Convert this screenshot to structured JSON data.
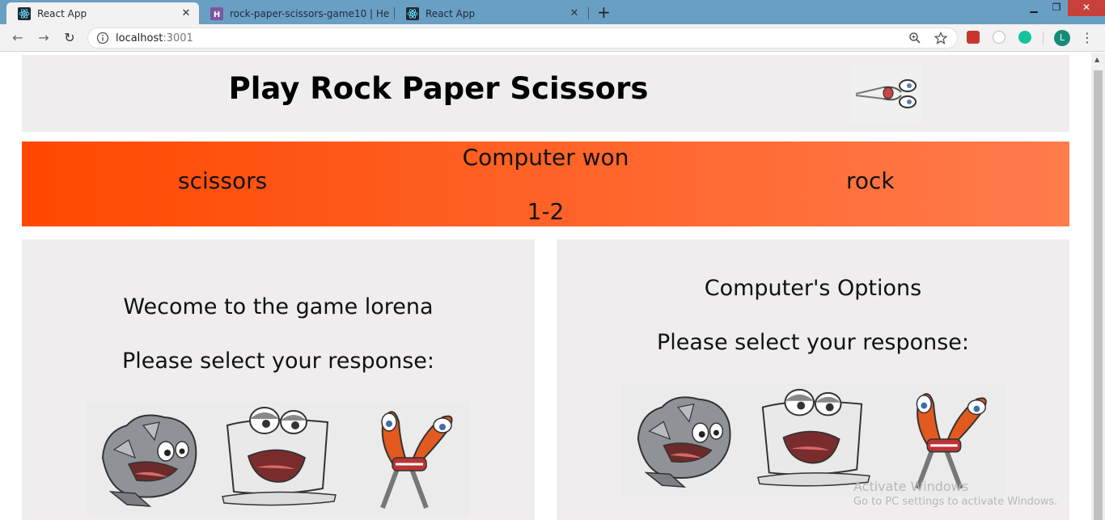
{
  "browser": {
    "tabs": [
      {
        "title": "React App",
        "active": true
      },
      {
        "title": "rock-paper-scissors-game10 | He",
        "active": false
      },
      {
        "title": "React App",
        "active": false
      }
    ],
    "close_glyph": "✕",
    "new_tab_glyph": "+",
    "url_host": "localhost",
    "url_port": ":3001",
    "profile_initial": "L",
    "accent": "#6a9fc4"
  },
  "header": {
    "title": "Play Rock Paper Scissors"
  },
  "result": {
    "status": "Computer won",
    "user_choice": "scissors",
    "computer_choice": "rock",
    "score": "1-2",
    "gradient_from": "#ff4800",
    "gradient_to": "#ff7c4d"
  },
  "player_panel": {
    "welcome": "Wecome to the game lorena",
    "prompt": "Please select your response:",
    "options": [
      "rock",
      "paper",
      "scissors"
    ]
  },
  "computer_panel": {
    "heading": "Computer's Options",
    "prompt": "Please select your response:",
    "options": [
      "rock",
      "paper",
      "scissors"
    ]
  },
  "watermark": {
    "line1": "Activate Windows",
    "line2": "Go to PC settings to activate Windows."
  }
}
